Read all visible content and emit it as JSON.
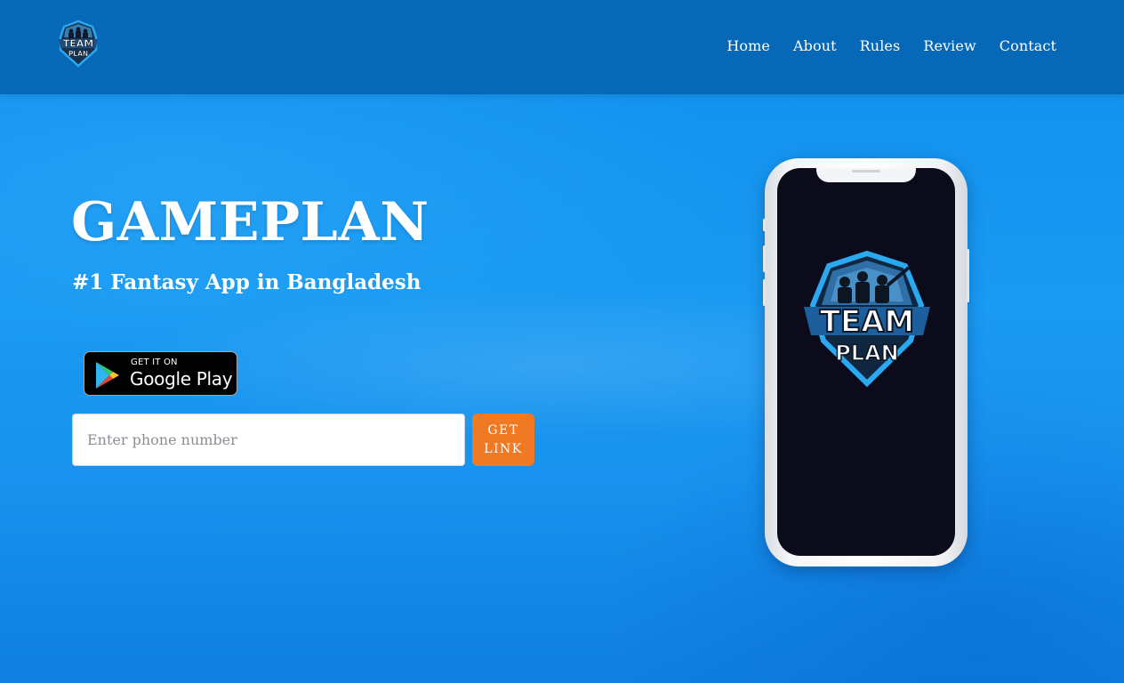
{
  "nav": {
    "logo_top_text": "TEAM",
    "logo_bottom_text": "PLAN",
    "links": [
      {
        "label": "Home"
      },
      {
        "label": "About"
      },
      {
        "label": "Rules"
      },
      {
        "label": "Review"
      },
      {
        "label": "Contact"
      }
    ]
  },
  "hero": {
    "title": "GAMEPLAN",
    "subtitle": "#1 Fantasy App in Bangladesh",
    "play_badge": {
      "small_text": "GET IT ON",
      "big_text": "Google Play"
    },
    "phone_input": {
      "placeholder": "Enter phone number",
      "value": ""
    },
    "get_link_label": "GET LINK"
  },
  "phone_mockup": {
    "logo_top_text": "TEAM",
    "logo_bottom_text": "PLAN"
  },
  "colors": {
    "navbar": "#0868b8",
    "hero_blue": "#1a95ee",
    "cta_orange": "#f07a24",
    "logo_blue": "#2aa8f0",
    "screen_dark": "#0b0b1c"
  },
  "icons": {
    "nav_logo": "team-plan-logo",
    "badge_icon": "google-play-icon",
    "screen_logo": "team-plan-logo"
  }
}
